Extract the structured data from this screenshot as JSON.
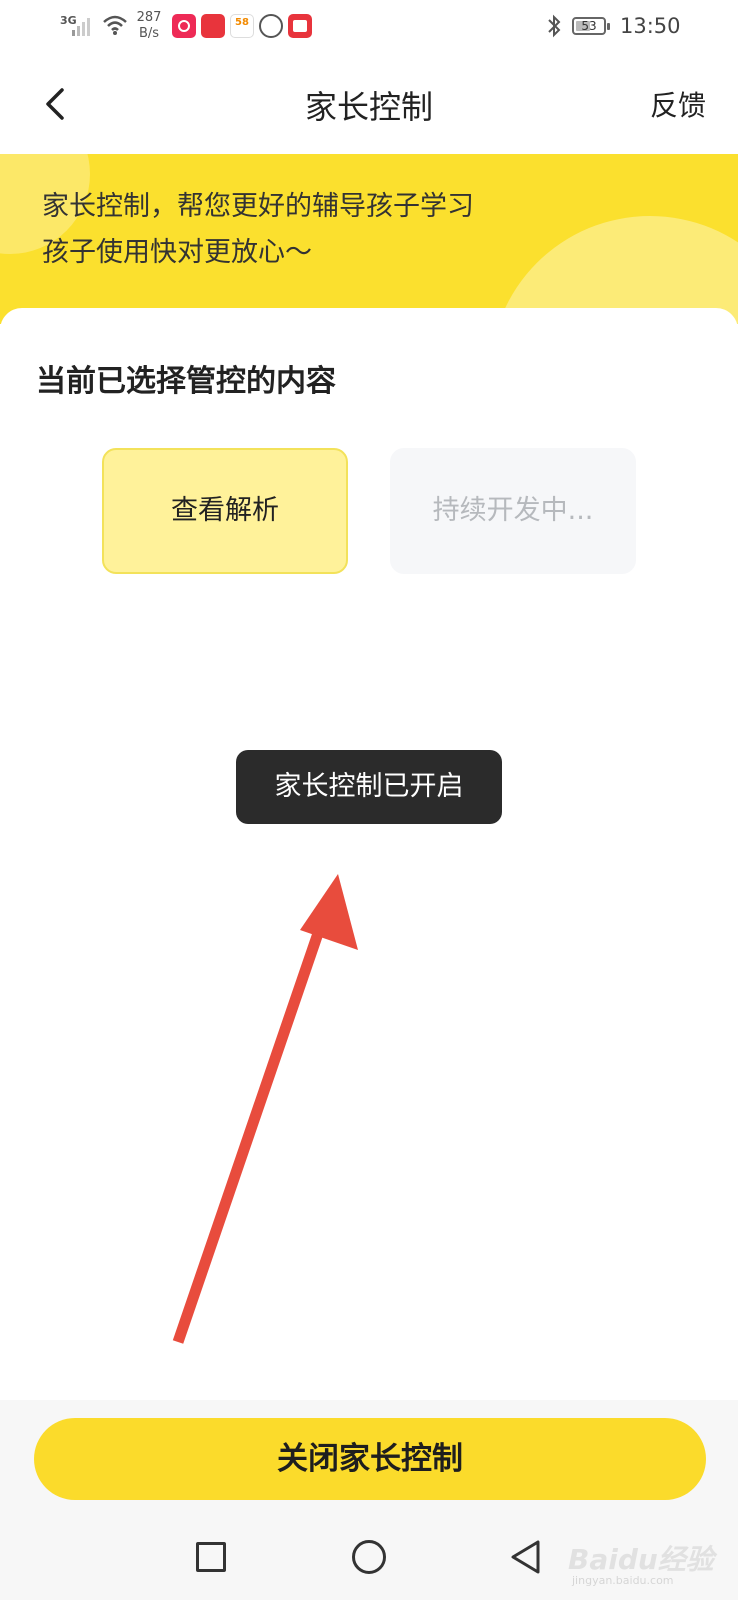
{
  "status_bar": {
    "network": "3G",
    "speed_value": "287",
    "speed_unit": "B/s",
    "battery_level": "53",
    "time": "13:50"
  },
  "nav": {
    "title": "家长控制",
    "feedback": "反馈"
  },
  "banner": {
    "line1": "家长控制，帮您更好的辅导孩子学习",
    "line2": "孩子使用快对更放心～"
  },
  "content": {
    "section_title": "当前已选择管控的内容",
    "options": [
      {
        "label": "查看解析",
        "selected": true
      },
      {
        "label": "持续开发中...",
        "selected": false
      }
    ]
  },
  "toast": {
    "message": "家长控制已开启"
  },
  "actions": {
    "close_label": "关闭家长控制"
  },
  "watermark": {
    "logo": "Baidu经验",
    "sub": "jingyan.baidu.com"
  },
  "colors": {
    "brand_yellow": "#fbdb2b",
    "banner_yellow": "#fbe02e",
    "option_active_bg": "#fff29a",
    "toast_bg": "#2b2b2b",
    "arrow_red": "#e84c3d"
  },
  "icons": {
    "back": "chevron-left-icon",
    "recent": "square-icon",
    "home": "circle-icon",
    "system_back": "triangle-left-icon"
  }
}
